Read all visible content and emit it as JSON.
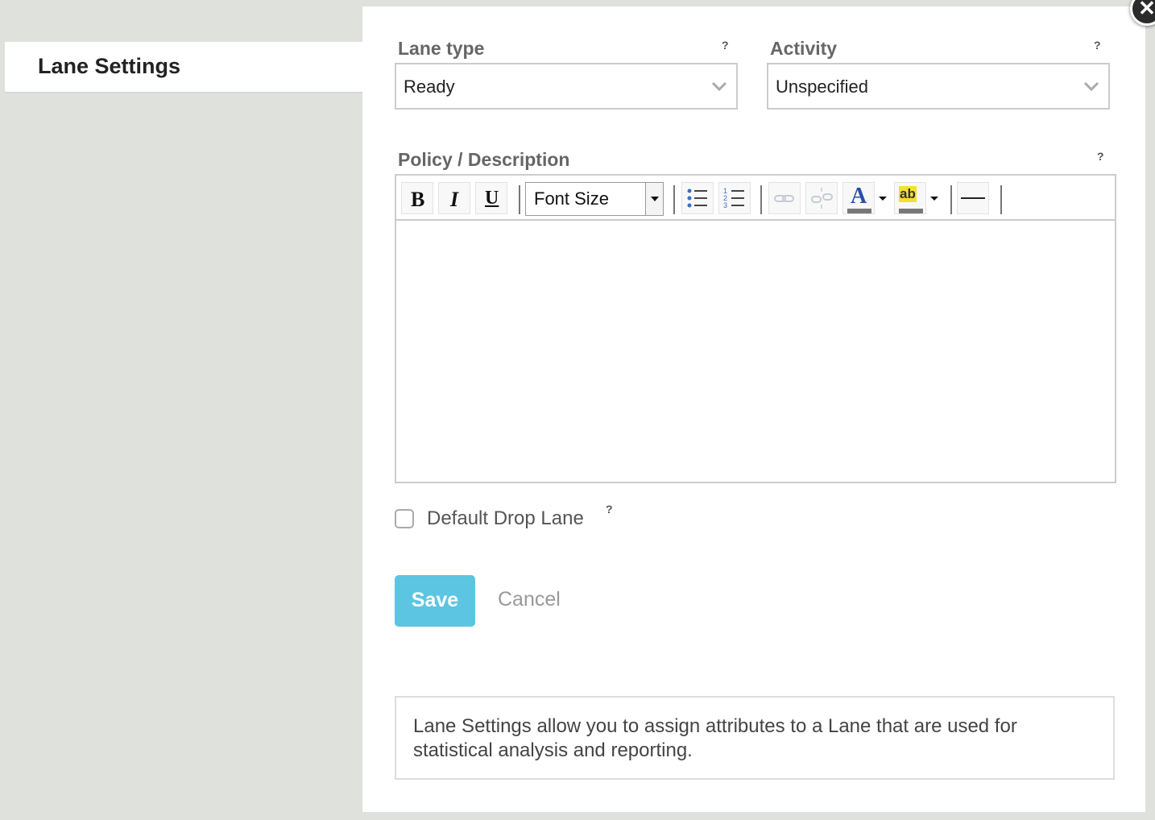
{
  "sidebar": {
    "title": "Lane Settings"
  },
  "lane_type": {
    "label": "Lane type",
    "help": "?",
    "value": "Ready"
  },
  "activity": {
    "label": "Activity",
    "help": "?",
    "value": "Unspecified"
  },
  "policy": {
    "label": "Policy / Description",
    "help": "?",
    "toolbar": {
      "bold": "B",
      "italic": "I",
      "underline": "U",
      "font_size": "Font Size",
      "font_color_glyph": "A",
      "highlight_glyph": "ab"
    },
    "content": ""
  },
  "default_drop_lane": {
    "label": "Default Drop Lane",
    "help": "?",
    "checked": false
  },
  "actions": {
    "save": "Save",
    "cancel": "Cancel"
  },
  "info": {
    "text": "Lane Settings allow you to assign attributes to a Lane that are used for statistical analysis and reporting."
  },
  "close": {
    "glyph": "✕"
  },
  "colors": {
    "accent": "#5bc5e2",
    "background": "#dfe1dc"
  }
}
